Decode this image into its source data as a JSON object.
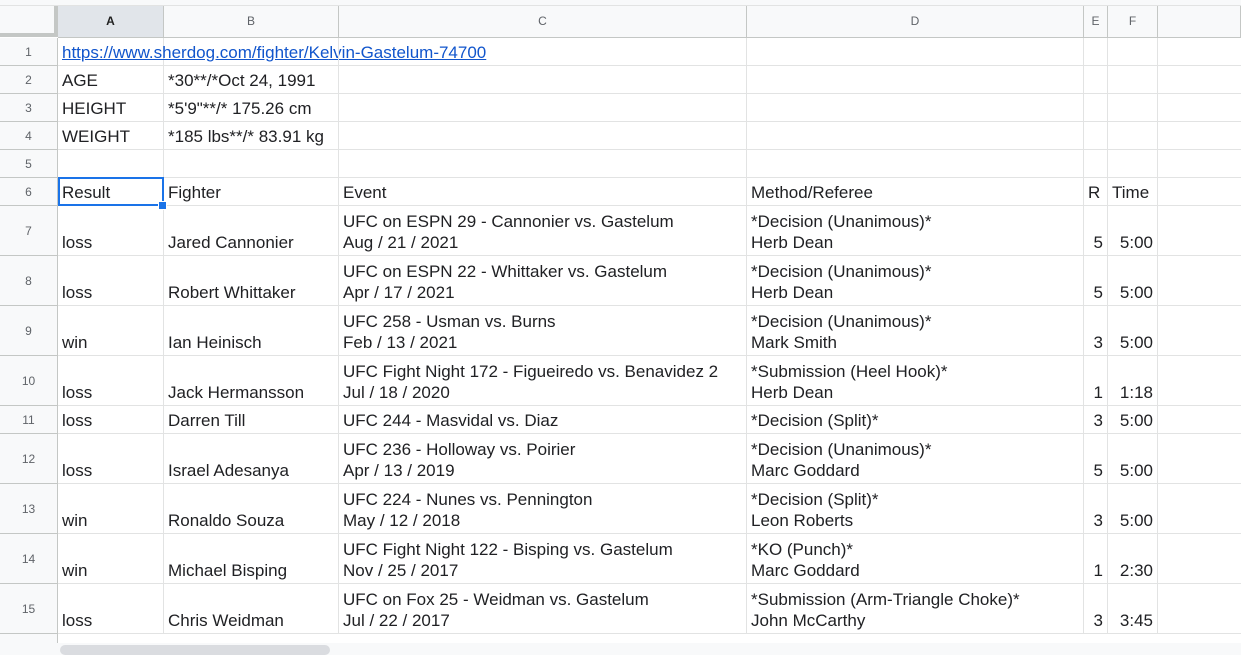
{
  "columns": [
    "A",
    "B",
    "C",
    "D",
    "E",
    "F"
  ],
  "rows": [
    {
      "num": "1",
      "A": {
        "lines": [
          "https://www.sherdog.com/fighter/Kelvin-Gastelum-74700"
        ],
        "link": true
      }
    },
    {
      "num": "2",
      "A": {
        "lines": [
          "AGE"
        ]
      },
      "B": {
        "lines": [
          "*30**/*Oct 24, 1991"
        ]
      }
    },
    {
      "num": "3",
      "A": {
        "lines": [
          "HEIGHT"
        ]
      },
      "B": {
        "lines": [
          "*5'9\"**/* 175.26 cm"
        ]
      }
    },
    {
      "num": "4",
      "A": {
        "lines": [
          "WEIGHT"
        ]
      },
      "B": {
        "lines": [
          "*185 lbs**/* 83.91 kg"
        ]
      }
    },
    {
      "num": "5"
    },
    {
      "num": "6",
      "A": {
        "lines": [
          "Result"
        ]
      },
      "B": {
        "lines": [
          "Fighter"
        ]
      },
      "C": {
        "lines": [
          "Event"
        ]
      },
      "D": {
        "lines": [
          "Method/Referee"
        ]
      },
      "E": {
        "lines": [
          "R"
        ]
      },
      "F": {
        "lines": [
          "Time"
        ]
      }
    },
    {
      "num": "7",
      "A": {
        "lines": [
          "loss"
        ]
      },
      "B": {
        "lines": [
          "Jared Cannonier"
        ]
      },
      "C": {
        "lines": [
          "UFC on ESPN 29 - Cannonier vs. Gastelum",
          "Aug / 21 / 2021"
        ]
      },
      "D": {
        "lines": [
          "*Decision (Unanimous)*",
          "Herb Dean"
        ]
      },
      "E": {
        "lines": [
          "5"
        ]
      },
      "F": {
        "lines": [
          "5:00"
        ]
      }
    },
    {
      "num": "8",
      "A": {
        "lines": [
          "loss"
        ]
      },
      "B": {
        "lines": [
          "Robert Whittaker"
        ]
      },
      "C": {
        "lines": [
          "UFC on ESPN 22 - Whittaker vs. Gastelum",
          "Apr / 17 / 2021"
        ]
      },
      "D": {
        "lines": [
          "*Decision (Unanimous)*",
          "Herb Dean"
        ]
      },
      "E": {
        "lines": [
          "5"
        ]
      },
      "F": {
        "lines": [
          "5:00"
        ]
      }
    },
    {
      "num": "9",
      "A": {
        "lines": [
          "win"
        ]
      },
      "B": {
        "lines": [
          "Ian Heinisch"
        ]
      },
      "C": {
        "lines": [
          "UFC 258 - Usman vs. Burns",
          "Feb / 13 / 2021"
        ]
      },
      "D": {
        "lines": [
          "*Decision (Unanimous)*",
          "Mark Smith"
        ]
      },
      "E": {
        "lines": [
          "3"
        ]
      },
      "F": {
        "lines": [
          "5:00"
        ]
      }
    },
    {
      "num": "10",
      "A": {
        "lines": [
          "loss"
        ]
      },
      "B": {
        "lines": [
          "Jack Hermansson"
        ]
      },
      "C": {
        "lines": [
          "UFC Fight Night 172 - Figueiredo vs. Benavidez 2",
          "Jul / 18 / 2020"
        ]
      },
      "D": {
        "lines": [
          "*Submission (Heel Hook)*",
          "Herb Dean"
        ]
      },
      "E": {
        "lines": [
          "1"
        ]
      },
      "F": {
        "lines": [
          "1:18"
        ]
      }
    },
    {
      "num": "11",
      "A": {
        "lines": [
          "loss"
        ]
      },
      "B": {
        "lines": [
          "Darren Till"
        ]
      },
      "C": {
        "lines": [
          "UFC 244 - Masvidal vs. Diaz"
        ]
      },
      "D": {
        "lines": [
          "*Decision (Split)*"
        ]
      },
      "E": {
        "lines": [
          "3"
        ]
      },
      "F": {
        "lines": [
          "5:00"
        ]
      }
    },
    {
      "num": "12",
      "A": {
        "lines": [
          "loss"
        ]
      },
      "B": {
        "lines": [
          "Israel Adesanya"
        ]
      },
      "C": {
        "lines": [
          "UFC 236 - Holloway vs. Poirier",
          "Apr / 13 / 2019"
        ]
      },
      "D": {
        "lines": [
          "*Decision (Unanimous)*",
          "Marc Goddard"
        ]
      },
      "E": {
        "lines": [
          "5"
        ]
      },
      "F": {
        "lines": [
          "5:00"
        ]
      }
    },
    {
      "num": "13",
      "A": {
        "lines": [
          "win"
        ]
      },
      "B": {
        "lines": [
          "Ronaldo Souza"
        ]
      },
      "C": {
        "lines": [
          "UFC 224 - Nunes vs. Pennington",
          "May / 12 / 2018"
        ]
      },
      "D": {
        "lines": [
          "*Decision (Split)*",
          "Leon Roberts"
        ]
      },
      "E": {
        "lines": [
          "3"
        ]
      },
      "F": {
        "lines": [
          "5:00"
        ]
      }
    },
    {
      "num": "14",
      "A": {
        "lines": [
          "win"
        ]
      },
      "B": {
        "lines": [
          "Michael Bisping"
        ]
      },
      "C": {
        "lines": [
          "UFC Fight Night 122 - Bisping vs. Gastelum",
          "Nov / 25 / 2017"
        ]
      },
      "D": {
        "lines": [
          "*KO (Punch)*",
          "Marc Goddard"
        ]
      },
      "E": {
        "lines": [
          "1"
        ]
      },
      "F": {
        "lines": [
          "2:30"
        ]
      }
    },
    {
      "num": "15",
      "A": {
        "lines": [
          "loss"
        ]
      },
      "B": {
        "lines": [
          "Chris Weidman"
        ]
      },
      "C": {
        "lines": [
          "UFC on Fox 25 - Weidman vs. Gastelum",
          "Jul / 22 / 2017"
        ]
      },
      "D": {
        "lines": [
          "*Submission (Arm-Triangle Choke)*",
          "John McCarthy"
        ]
      },
      "E": {
        "lines": [
          "3"
        ]
      },
      "F": {
        "lines": [
          "3:45"
        ]
      }
    }
  ],
  "selected_cell": "A6"
}
